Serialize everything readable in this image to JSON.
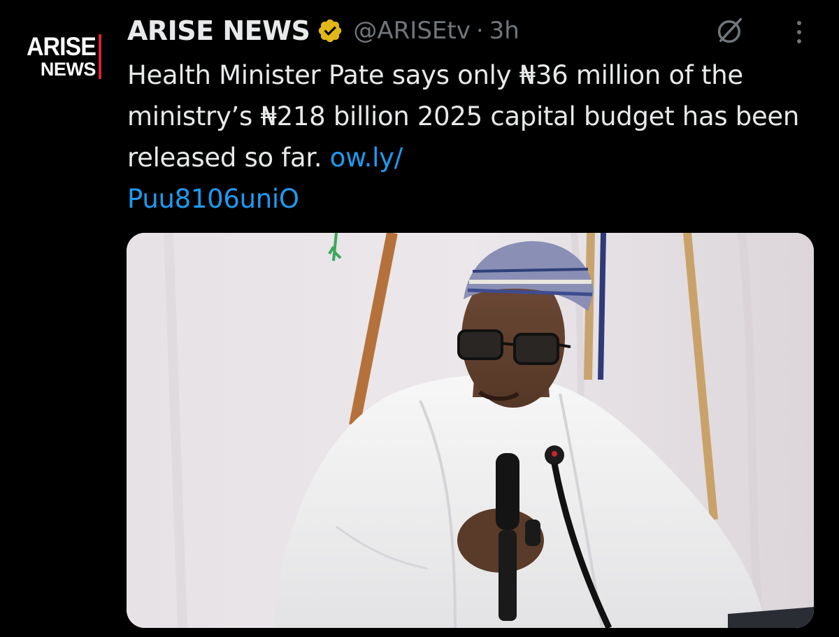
{
  "account": {
    "display_name": "ARISE NEWS",
    "handle": "@ARISEtv",
    "separator": "·",
    "time": "3h",
    "avatar_logo": {
      "line1": "ARISE",
      "line2": "NEWS"
    },
    "verified_badge_color": "#e2b719"
  },
  "tweet": {
    "text": "Health Minister Pate says only ₦36 million of the ministry’s ₦218 billion 2025 capital budget has been released so far. ",
    "link_text": "ow.ly/\nPuu8106uniO"
  },
  "icons": {
    "grok": "grok-icon",
    "more": "more-options-icon",
    "verified": "verified-badge-icon"
  },
  "colors": {
    "background": "#000000",
    "text": "#e7e9ea",
    "secondary": "#71767b",
    "link": "#1d9bf0",
    "brand_accent": "#d7262f"
  }
}
